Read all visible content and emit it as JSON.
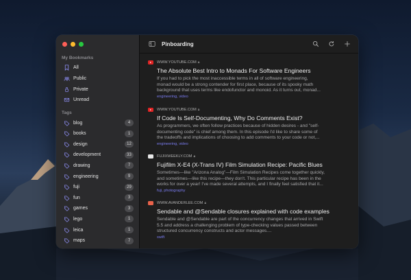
{
  "window": {
    "title": "Pinboarding"
  },
  "sidebar": {
    "bookmarks_label": "My Bookmarks",
    "bookmarks": [
      {
        "label": "All",
        "icon": "bookmark-icon"
      },
      {
        "label": "Public",
        "icon": "people-icon"
      },
      {
        "label": "Private",
        "icon": "lock-icon"
      },
      {
        "label": "Unread",
        "icon": "envelope-icon"
      }
    ],
    "tags_label": "Tags",
    "tags": [
      {
        "label": "blog",
        "count": "4"
      },
      {
        "label": "books",
        "count": "1"
      },
      {
        "label": "design",
        "count": "12"
      },
      {
        "label": "development",
        "count": "33"
      },
      {
        "label": "drawing",
        "count": "7"
      },
      {
        "label": "engineering",
        "count": "9"
      },
      {
        "label": "fuji",
        "count": "29"
      },
      {
        "label": "fun",
        "count": "3"
      },
      {
        "label": "games",
        "count": "3"
      },
      {
        "label": "lego",
        "count": "1"
      },
      {
        "label": "leica",
        "count": "1"
      },
      {
        "label": "maps",
        "count": "7"
      }
    ]
  },
  "toolbar": {
    "icons": [
      "sidebar-toggle-icon",
      "search-icon",
      "refresh-icon",
      "plus-icon"
    ]
  },
  "items": [
    {
      "source": "WWW.YOUTUBE.COM",
      "favicon": "youtube-icon",
      "title": "The Absolute Best Intro to Monads For Software Engineers",
      "desc1": "If you had to pick the most inaccessible terms in all of software engineering,",
      "desc2": "monad would be a strong contender for first place, because of its spooky math",
      "desc3": "background that uses terms like endofunctor and monoid. As it turns out, monad...",
      "tags": "engineering, video"
    },
    {
      "source": "WWW.YOUTUBE.COM",
      "favicon": "youtube-icon",
      "title": "If Code Is Self-Documenting, Why Do Comments Exist?",
      "desc1": "As programmers, we often follow practices because of hidden desires - and \"self-",
      "desc2": "documenting code\" is chief among them. In this episode I'd like to share some of",
      "desc3": "the tradeoffs and implications of choosing to add comments to your code or not,...",
      "tags": "engineering, video"
    },
    {
      "source": "FUJIXWEEKLY.COM",
      "favicon": "fujix-icon",
      "title": "Fujifilm X-E4 (X-Trans IV) Film Simulation Recipe: Pacific Blues",
      "desc1": "Sometimes—like \"Arizona Analog\"—Film Simulation Recipes come together quickly,",
      "desc2": "and sometimes—like this recipe—they don't. This particular recipe has been in the",
      "desc3": "works for over a year! I've made several attempts, and I finally feel satisfied that it...",
      "tags": "fuji, photography"
    },
    {
      "source": "WWW.AVANDERLEE.COM",
      "favicon": "avanderlee-icon",
      "title": "Sendable and @Sendable closures explained with code examples",
      "desc1": "Sendable and @Sendable are part of the concurrency changes that arrived in Swift",
      "desc2": "5.5 and address a challenging problem of type-checking values passed between",
      "desc3": "structured concurrency constructs and actor messages....",
      "tags": "swift"
    }
  ]
}
